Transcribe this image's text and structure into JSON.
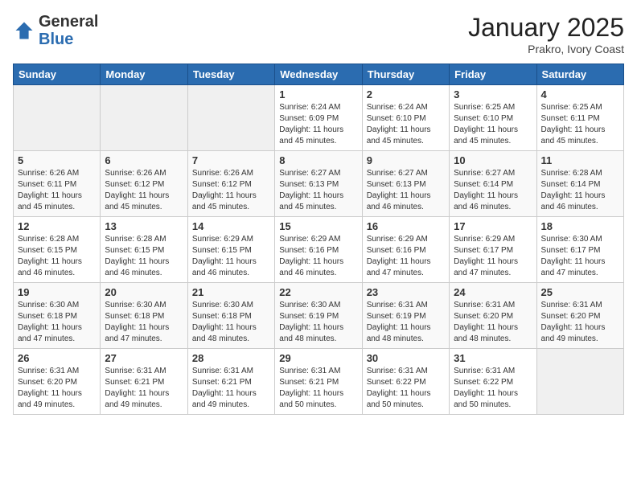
{
  "header": {
    "logo_general": "General",
    "logo_blue": "Blue",
    "month": "January 2025",
    "location": "Prakro, Ivory Coast"
  },
  "days_of_week": [
    "Sunday",
    "Monday",
    "Tuesday",
    "Wednesday",
    "Thursday",
    "Friday",
    "Saturday"
  ],
  "weeks": [
    [
      {
        "day": "",
        "info": ""
      },
      {
        "day": "",
        "info": ""
      },
      {
        "day": "",
        "info": ""
      },
      {
        "day": "1",
        "info": "Sunrise: 6:24 AM\nSunset: 6:09 PM\nDaylight: 11 hours\nand 45 minutes."
      },
      {
        "day": "2",
        "info": "Sunrise: 6:24 AM\nSunset: 6:10 PM\nDaylight: 11 hours\nand 45 minutes."
      },
      {
        "day": "3",
        "info": "Sunrise: 6:25 AM\nSunset: 6:10 PM\nDaylight: 11 hours\nand 45 minutes."
      },
      {
        "day": "4",
        "info": "Sunrise: 6:25 AM\nSunset: 6:11 PM\nDaylight: 11 hours\nand 45 minutes."
      }
    ],
    [
      {
        "day": "5",
        "info": "Sunrise: 6:26 AM\nSunset: 6:11 PM\nDaylight: 11 hours\nand 45 minutes."
      },
      {
        "day": "6",
        "info": "Sunrise: 6:26 AM\nSunset: 6:12 PM\nDaylight: 11 hours\nand 45 minutes."
      },
      {
        "day": "7",
        "info": "Sunrise: 6:26 AM\nSunset: 6:12 PM\nDaylight: 11 hours\nand 45 minutes."
      },
      {
        "day": "8",
        "info": "Sunrise: 6:27 AM\nSunset: 6:13 PM\nDaylight: 11 hours\nand 45 minutes."
      },
      {
        "day": "9",
        "info": "Sunrise: 6:27 AM\nSunset: 6:13 PM\nDaylight: 11 hours\nand 46 minutes."
      },
      {
        "day": "10",
        "info": "Sunrise: 6:27 AM\nSunset: 6:14 PM\nDaylight: 11 hours\nand 46 minutes."
      },
      {
        "day": "11",
        "info": "Sunrise: 6:28 AM\nSunset: 6:14 PM\nDaylight: 11 hours\nand 46 minutes."
      }
    ],
    [
      {
        "day": "12",
        "info": "Sunrise: 6:28 AM\nSunset: 6:15 PM\nDaylight: 11 hours\nand 46 minutes."
      },
      {
        "day": "13",
        "info": "Sunrise: 6:28 AM\nSunset: 6:15 PM\nDaylight: 11 hours\nand 46 minutes."
      },
      {
        "day": "14",
        "info": "Sunrise: 6:29 AM\nSunset: 6:15 PM\nDaylight: 11 hours\nand 46 minutes."
      },
      {
        "day": "15",
        "info": "Sunrise: 6:29 AM\nSunset: 6:16 PM\nDaylight: 11 hours\nand 46 minutes."
      },
      {
        "day": "16",
        "info": "Sunrise: 6:29 AM\nSunset: 6:16 PM\nDaylight: 11 hours\nand 47 minutes."
      },
      {
        "day": "17",
        "info": "Sunrise: 6:29 AM\nSunset: 6:17 PM\nDaylight: 11 hours\nand 47 minutes."
      },
      {
        "day": "18",
        "info": "Sunrise: 6:30 AM\nSunset: 6:17 PM\nDaylight: 11 hours\nand 47 minutes."
      }
    ],
    [
      {
        "day": "19",
        "info": "Sunrise: 6:30 AM\nSunset: 6:18 PM\nDaylight: 11 hours\nand 47 minutes."
      },
      {
        "day": "20",
        "info": "Sunrise: 6:30 AM\nSunset: 6:18 PM\nDaylight: 11 hours\nand 47 minutes."
      },
      {
        "day": "21",
        "info": "Sunrise: 6:30 AM\nSunset: 6:18 PM\nDaylight: 11 hours\nand 48 minutes."
      },
      {
        "day": "22",
        "info": "Sunrise: 6:30 AM\nSunset: 6:19 PM\nDaylight: 11 hours\nand 48 minutes."
      },
      {
        "day": "23",
        "info": "Sunrise: 6:31 AM\nSunset: 6:19 PM\nDaylight: 11 hours\nand 48 minutes."
      },
      {
        "day": "24",
        "info": "Sunrise: 6:31 AM\nSunset: 6:20 PM\nDaylight: 11 hours\nand 48 minutes."
      },
      {
        "day": "25",
        "info": "Sunrise: 6:31 AM\nSunset: 6:20 PM\nDaylight: 11 hours\nand 49 minutes."
      }
    ],
    [
      {
        "day": "26",
        "info": "Sunrise: 6:31 AM\nSunset: 6:20 PM\nDaylight: 11 hours\nand 49 minutes."
      },
      {
        "day": "27",
        "info": "Sunrise: 6:31 AM\nSunset: 6:21 PM\nDaylight: 11 hours\nand 49 minutes."
      },
      {
        "day": "28",
        "info": "Sunrise: 6:31 AM\nSunset: 6:21 PM\nDaylight: 11 hours\nand 49 minutes."
      },
      {
        "day": "29",
        "info": "Sunrise: 6:31 AM\nSunset: 6:21 PM\nDaylight: 11 hours\nand 50 minutes."
      },
      {
        "day": "30",
        "info": "Sunrise: 6:31 AM\nSunset: 6:22 PM\nDaylight: 11 hours\nand 50 minutes."
      },
      {
        "day": "31",
        "info": "Sunrise: 6:31 AM\nSunset: 6:22 PM\nDaylight: 11 hours\nand 50 minutes."
      },
      {
        "day": "",
        "info": ""
      }
    ]
  ]
}
